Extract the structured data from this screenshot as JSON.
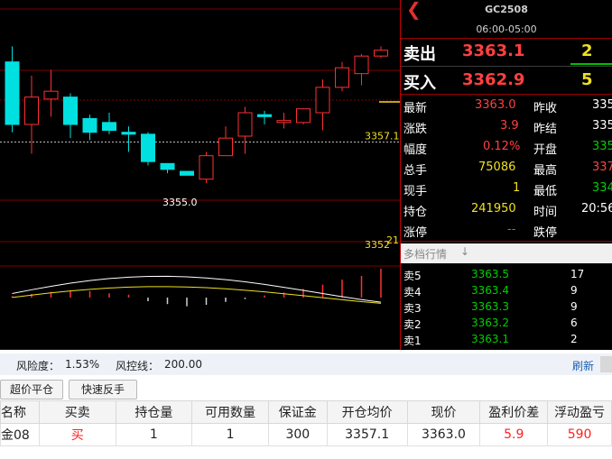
{
  "symbol": "GC2508",
  "session": "06:00-05:00",
  "ask": {
    "label": "卖出",
    "price": "3363.1",
    "size": "2"
  },
  "bid": {
    "label": "买入",
    "price": "3362.9",
    "size": "5"
  },
  "quote": {
    "latest_label": "最新",
    "latest": "3363.0",
    "prev_close_label": "昨收",
    "prev_close": "335",
    "change_label": "涨跌",
    "change": "3.9",
    "prev_settle_label": "昨结",
    "prev_settle": "335",
    "pct_label": "幅度",
    "pct": "0.12%",
    "open_label": "开盘",
    "open": "335",
    "volume_label": "总手",
    "volume": "75086",
    "high_label": "最高",
    "high": "337",
    "current_label": "现手",
    "current": "1",
    "low_label": "最低",
    "low": "334",
    "oi_label": "持仓",
    "oi": "241950",
    "time_label": "时间",
    "time": "20:56",
    "limit_up_label": "涨停",
    "limit_up": "--",
    "limit_down_label": "跌停"
  },
  "depth": {
    "header": "多档行情",
    "rows": [
      {
        "label": "卖5",
        "price": "3363.5",
        "qty": "17"
      },
      {
        "label": "卖4",
        "price": "3363.4",
        "qty": "9"
      },
      {
        "label": "卖3",
        "price": "3363.3",
        "qty": "9"
      },
      {
        "label": "卖2",
        "price": "3363.2",
        "qty": "6"
      },
      {
        "label": "卖1",
        "price": "3363.1",
        "qty": "2"
      }
    ]
  },
  "chart_labels": {
    "avg_price": "3357.1",
    "low_mark": "3355.0",
    "bottom_price": "3352",
    "bottom_price_suffix": "21"
  },
  "risk": {
    "ratio_label": "风险度：",
    "ratio": "1.53%",
    "line_label": "风控线：",
    "line": "200.00",
    "refresh": "刷新"
  },
  "buttons": {
    "market_close": "超价平仓",
    "reverse": "快速反手"
  },
  "positions": {
    "headers": [
      "名称",
      "买卖",
      "持仓量",
      "可用数量",
      "保证金",
      "开仓均价",
      "现价",
      "盈利价差",
      "浮动盈亏"
    ],
    "row": [
      "金08",
      "买",
      "1",
      "1",
      "300",
      "3357.1",
      "3363.0",
      "5.9",
      "590"
    ]
  },
  "colors": {
    "up": "#ff3030",
    "down": "#00e0e0",
    "bg": "#000000",
    "grid": "#800000"
  },
  "chart_data": {
    "type": "candlestick",
    "ohlc": [
      [
        3361.2,
        3362.0,
        3357.6,
        3358.0
      ],
      [
        3358.0,
        3360.5,
        3356.5,
        3359.4
      ],
      [
        3359.3,
        3360.8,
        3358.4,
        3359.7
      ],
      [
        3359.4,
        3359.6,
        3357.3,
        3358.0
      ],
      [
        3358.3,
        3358.5,
        3357.2,
        3357.6
      ],
      [
        3358.1,
        3358.6,
        3357.5,
        3357.7
      ],
      [
        3357.6,
        3357.9,
        3356.6,
        3357.5
      ],
      [
        3357.5,
        3357.6,
        3355.9,
        3356.1
      ],
      [
        3356.0,
        3356.0,
        3355.5,
        3355.7
      ],
      [
        3355.6,
        3355.6,
        3355.4,
        3355.4
      ],
      [
        3355.2,
        3356.6,
        3355.0,
        3356.4
      ],
      [
        3356.4,
        3357.9,
        3356.4,
        3357.3
      ],
      [
        3357.4,
        3358.9,
        3356.5,
        3358.6
      ],
      [
        3358.5,
        3358.7,
        3358.0,
        3358.4
      ],
      [
        3358.1,
        3358.6,
        3357.8,
        3358.2
      ],
      [
        3358.1,
        3358.8,
        3358.0,
        3358.8
      ],
      [
        3358.6,
        3360.3,
        3357.7,
        3359.9
      ],
      [
        3359.9,
        3361.2,
        3359.7,
        3360.9
      ],
      [
        3360.6,
        3361.6,
        3360.0,
        3361.5
      ],
      [
        3361.5,
        3362.0,
        3361.4,
        3361.8
      ]
    ],
    "volume": [
      2,
      3,
      1,
      2,
      1,
      4,
      3,
      1,
      2,
      3,
      4,
      2,
      1,
      3,
      2,
      1,
      3,
      4,
      5,
      9
    ],
    "macd_hist": [
      0.2,
      0.5,
      0.8,
      1.0,
      0.9,
      0.6,
      0.4,
      -0.5,
      -0.9,
      -1.2,
      -1.0,
      -0.6,
      -0.2,
      0.3,
      0.7,
      1.2,
      1.8,
      2.5,
      3.0,
      4.0
    ],
    "avg_price": 3357.1,
    "ylim": [
      3352,
      3364
    ]
  }
}
